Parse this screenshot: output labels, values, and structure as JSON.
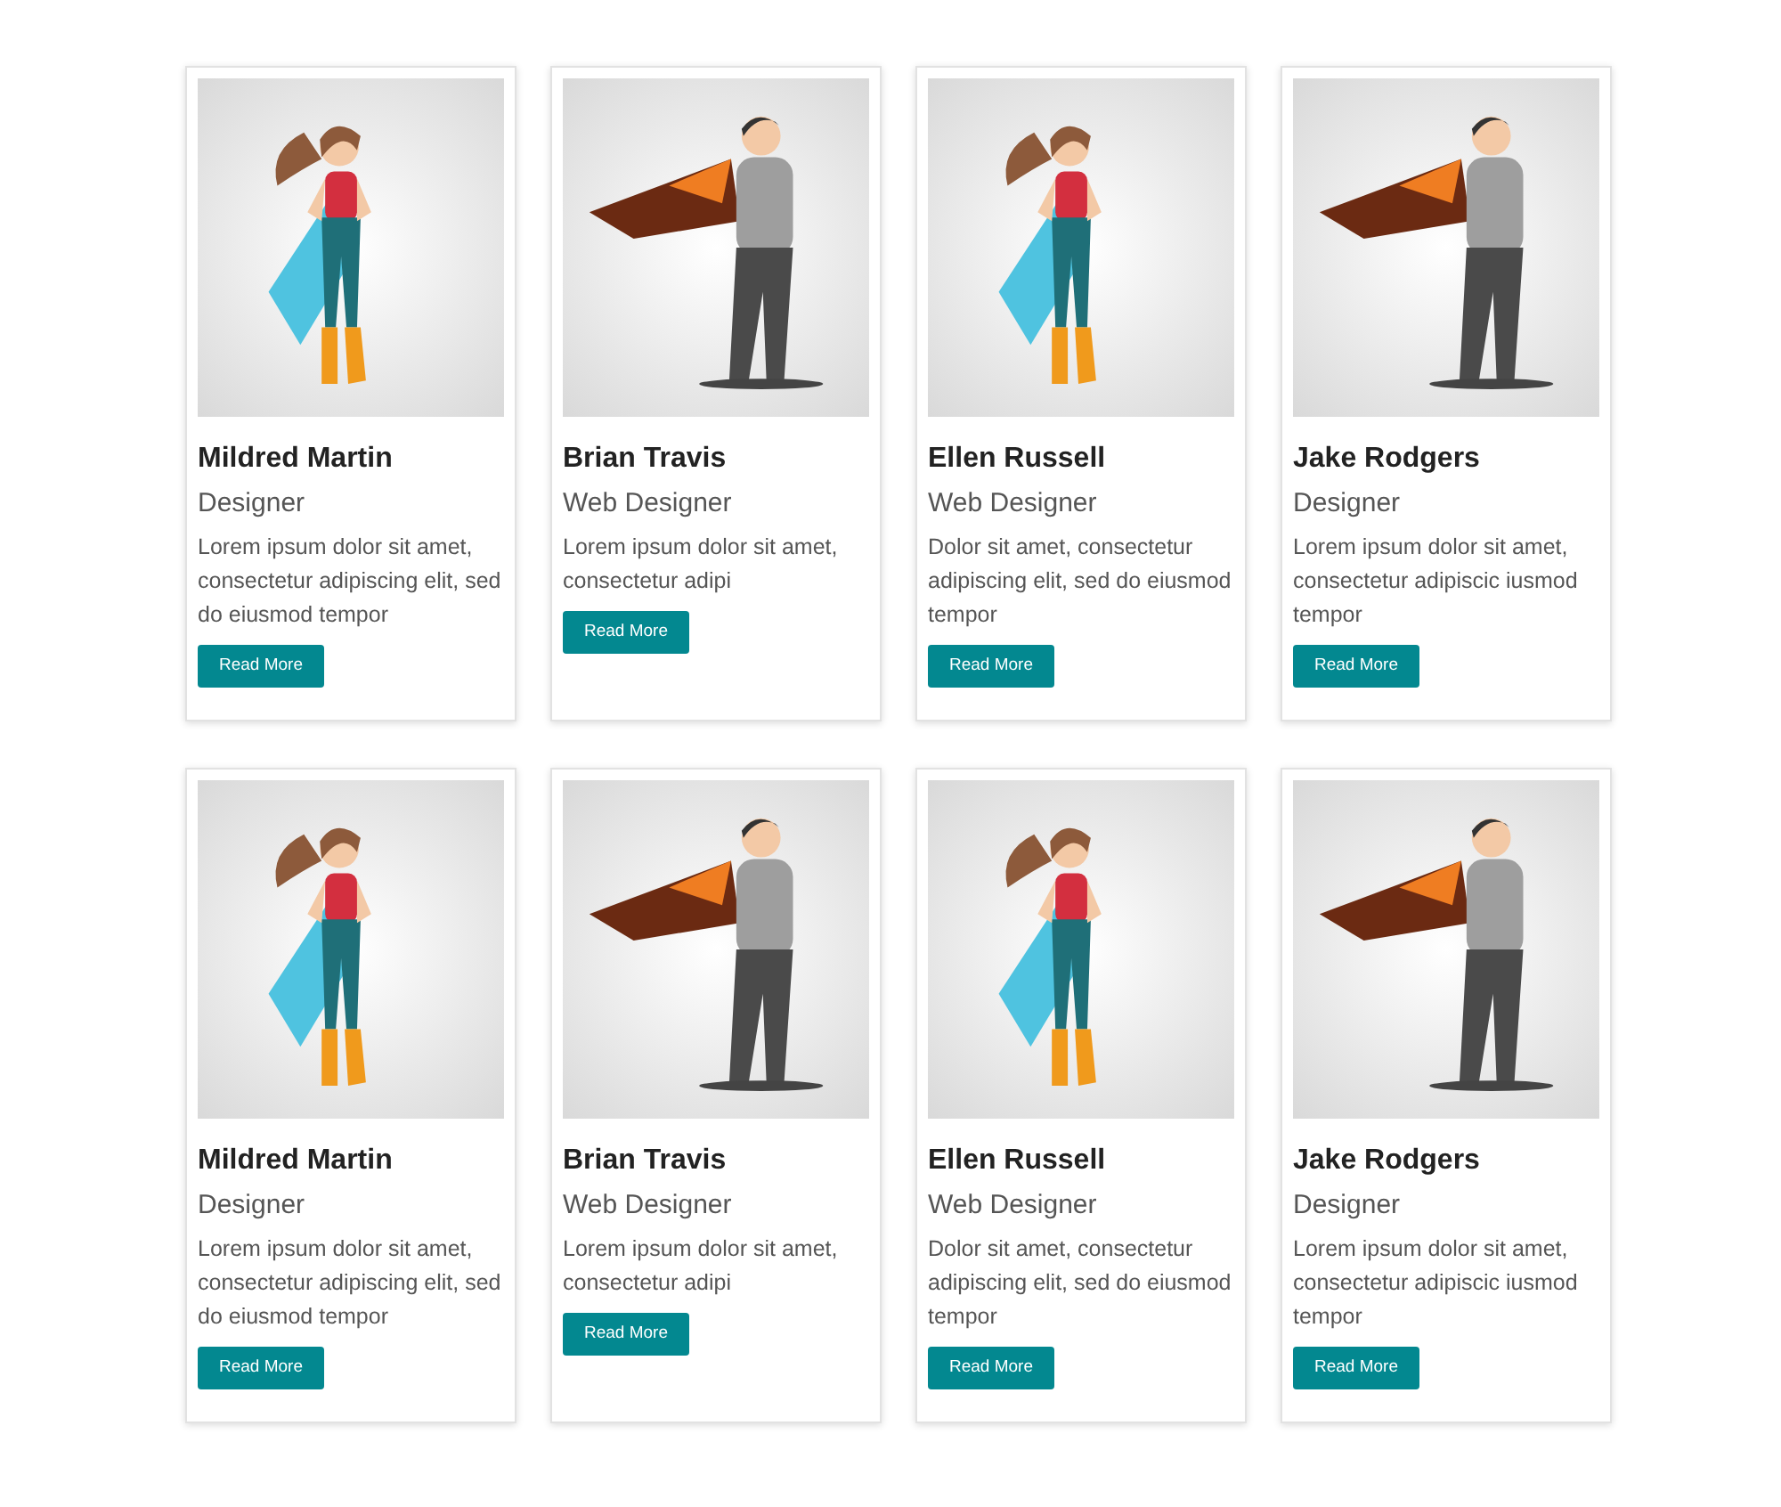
{
  "cards": [
    {
      "kind": "heroine",
      "name": "Mildred Martin",
      "role": "Designer",
      "text": "Lorem ipsum dolor sit amet, consectetur adipiscing elit, sed do eiusmod tempor",
      "button": "Read More"
    },
    {
      "kind": "hero",
      "name": "Brian Travis",
      "role": "Web Designer",
      "text": "Lorem ipsum dolor sit amet, consectetur adipi",
      "button": "Read More"
    },
    {
      "kind": "heroine",
      "name": "Ellen Russell",
      "role": "Web Designer",
      "text": "Dolor sit amet, consectetur adipiscing elit, sed do eiusmod tempor",
      "button": "Read More"
    },
    {
      "kind": "hero",
      "name": "Jake Rodgers",
      "role": "Designer",
      "text": "Lorem ipsum dolor sit amet, consectetur adipiscic iusmod tempor",
      "button": "Read More"
    },
    {
      "kind": "heroine",
      "name": "Mildred Martin",
      "role": "Designer",
      "text": "Lorem ipsum dolor sit amet, consectetur adipiscing elit, sed do eiusmod tempor",
      "button": "Read More"
    },
    {
      "kind": "hero",
      "name": "Brian Travis",
      "role": "Web Designer",
      "text": "Lorem ipsum dolor sit amet, consectetur adipi",
      "button": "Read More"
    },
    {
      "kind": "heroine",
      "name": "Ellen Russell",
      "role": "Web Designer",
      "text": "Dolor sit amet, consectetur adipiscing elit, sed do eiusmod tempor",
      "button": "Read More"
    },
    {
      "kind": "hero",
      "name": "Jake Rodgers",
      "role": "Designer",
      "text": "Lorem ipsum dolor sit amet, consectetur adipiscic iusmod tempor",
      "button": "Read More"
    }
  ]
}
